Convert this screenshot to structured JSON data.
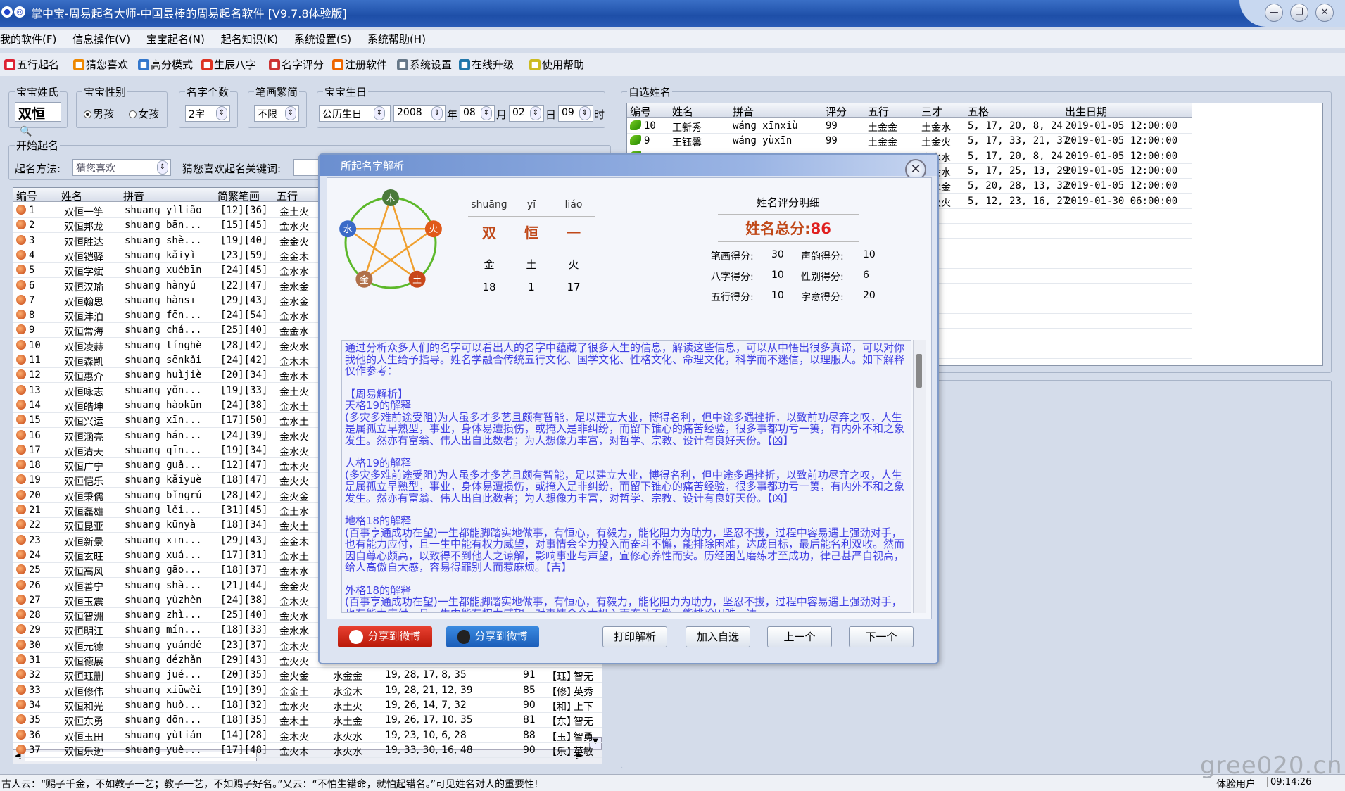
{
  "app": {
    "title": "掌中宝-周易起名大师-中国最棒的周易起名软件 [V9.7.8体验版]"
  },
  "menu": [
    "我的软件(F)",
    "信息操作(V)",
    "宝宝起名(N)",
    "起名知识(K)",
    "系统设置(S)",
    "系统帮助(H)"
  ],
  "toolbar": [
    {
      "label": "五行起名",
      "icon": "wuxing-icon",
      "color": "#d23"
    },
    {
      "label": "猜您喜欢",
      "icon": "star-icon",
      "color": "#e80"
    },
    {
      "label": "高分模式",
      "icon": "chart-icon",
      "color": "#37c"
    },
    {
      "label": "生辰八字",
      "icon": "calendar-icon",
      "color": "#d32"
    },
    {
      "label": "名字评分",
      "icon": "score-icon",
      "color": "#c33"
    },
    {
      "label": "注册软件",
      "icon": "gift-icon",
      "color": "#e60"
    },
    {
      "label": "系统设置",
      "icon": "settings-icon",
      "color": "#678"
    },
    {
      "label": "在线升级",
      "icon": "globe-icon",
      "color": "#27a"
    },
    {
      "label": "使用帮助",
      "icon": "help-icon",
      "color": "#cb2"
    }
  ],
  "settings": {
    "surname_label": "宝宝姓氏",
    "surname": "双恒",
    "gender_label": "宝宝性别",
    "male": "男孩",
    "female": "女孩",
    "count_label": "名字个数",
    "count": "2字",
    "stroke_label": "笔画繁简",
    "stroke": "不限",
    "birth_label": "宝宝生日",
    "calendar": "公历生日",
    "year": "2008",
    "year_unit": "年",
    "month": "08",
    "month_unit": "月",
    "day": "02",
    "day_unit": "日",
    "hour": "09",
    "hour_unit": "时"
  },
  "start": {
    "label": "开始起名",
    "method_label": "起名方法:",
    "method": "猜您喜欢",
    "keyword_label": "猜您喜欢起名关键词:"
  },
  "left_list": {
    "headers": [
      "编号",
      "姓名",
      "拼音",
      "简繁笔画",
      "五行"
    ],
    "rows": [
      [
        "1",
        "双恒一竽",
        "shuanɡ yìlião",
        "[12][36]",
        "金土火"
      ],
      [
        "2",
        "双恒邦龙",
        "shuanɡ bān...",
        "[15][45]",
        "金水火"
      ],
      [
        "3",
        "双恒胜达",
        "shuanɡ shè...",
        "[19][40]",
        "金金火"
      ],
      [
        "4",
        "双恒铠驿",
        "shuanɡ kǎiyì",
        "[23][59]",
        "金金木"
      ],
      [
        "5",
        "双恒学斌",
        "shuanɡ xuébīn",
        "[24][45]",
        "金水水"
      ],
      [
        "6",
        "双恒汉瑜",
        "shuanɡ hànyú",
        "[22][47]",
        "金水金"
      ],
      [
        "7",
        "双恒翰思",
        "shuanɡ hànsī",
        "[29][43]",
        "金水金"
      ],
      [
        "8",
        "双恒沣泊",
        "shuanɡ fēn...",
        "[24][54]",
        "金水水"
      ],
      [
        "9",
        "双恒常海",
        "shuanɡ chá...",
        "[25][40]",
        "金金水"
      ],
      [
        "10",
        "双恒凌赫",
        "shuanɡ línɡhè",
        "[28][42]",
        "金火水"
      ],
      [
        "11",
        "双恒森凯",
        "shuanɡ sēnkǎi",
        "[24][42]",
        "金木木"
      ],
      [
        "12",
        "双恒惠介",
        "shuanɡ huìjiè",
        "[20][34]",
        "金水木"
      ],
      [
        "13",
        "双恒咏志",
        "shuanɡ yǒn...",
        "[19][33]",
        "金土火"
      ],
      [
        "14",
        "双恒皓坤",
        "shuanɡ hàokūn",
        "[24][38]",
        "金水土"
      ],
      [
        "15",
        "双恒兴运",
        "shuanɡ xīn...",
        "[17][50]",
        "金水土"
      ],
      [
        "16",
        "双恒涵亮",
        "shuanɡ hán...",
        "[24][39]",
        "金水火"
      ],
      [
        "17",
        "双恒清天",
        "shuanɡ qīn...",
        "[19][34]",
        "金水火"
      ],
      [
        "18",
        "双恒广宁",
        "shuanɡ ɡuǎ...",
        "[12][47]",
        "金木火"
      ],
      [
        "19",
        "双恒恺乐",
        "shuanɡ kǎiyuè",
        "[18][47]",
        "金火火"
      ],
      [
        "20",
        "双恒秉儒",
        "shuanɡ bǐnɡrú",
        "[28][42]",
        "金火金"
      ],
      [
        "21",
        "双恒磊雄",
        "shuanɡ lěi...",
        "[31][45]",
        "金土水"
      ],
      [
        "22",
        "双恒昆亚",
        "shuanɡ kūnyà",
        "[18][34]",
        "金火土"
      ],
      [
        "23",
        "双恒新景",
        "shuanɡ xīn...",
        "[29][43]",
        "金金木"
      ],
      [
        "24",
        "双恒玄旺",
        "shuanɡ xuá...",
        "[17][31]",
        "金水土"
      ],
      [
        "25",
        "双恒高风",
        "shuanɡ ɡāo...",
        "[18][37]",
        "金木水"
      ],
      [
        "26",
        "双恒善宁",
        "shuanɡ shà...",
        "[21][44]",
        "金金火"
      ],
      [
        "27",
        "双恒玉震",
        "shuanɡ yùzhèn",
        "[24][38]",
        "金木火"
      ],
      [
        "28",
        "双恒智洲",
        "shuanɡ zhì...",
        "[25][40]",
        "金火水"
      ],
      [
        "29",
        "双恒明江",
        "shuanɡ mín...",
        "[18][33]",
        "金水水"
      ],
      [
        "30",
        "双恒元德",
        "shuanɡ yuándé",
        "[23][37]",
        "金木火"
      ],
      [
        "31",
        "双恒德展",
        "shuanɡ dézhǎn",
        "[29][43]",
        "金火火"
      ],
      [
        "32",
        "双恒珏删",
        "shuanɡ jué...",
        "[20][35]",
        "金火金",
        "水金金",
        "19, 28, 17, 8, 35",
        "91",
        "【珏】",
        "智无"
      ],
      [
        "33",
        "双恒修伟",
        "shuanɡ xiūwěi",
        "[19][39]",
        "金金土",
        "水金木",
        "19, 28, 21, 12, 39",
        "85",
        "【修】",
        "英秀"
      ],
      [
        "34",
        "双恒和光",
        "shuanɡ huò...",
        "[18][32]",
        "金水火",
        "水土火",
        "19, 26, 14, 7, 32",
        "90",
        "【和】",
        "上下"
      ],
      [
        "35",
        "双恒东勇",
        "shuanɡ dōn...",
        "[18][35]",
        "金木土",
        "水土金",
        "19, 26, 17, 10, 35",
        "81",
        "【东】",
        "智无"
      ],
      [
        "36",
        "双恒玉田",
        "shuanɡ yùtián",
        "[14][28]",
        "金木火",
        "水火水",
        "19, 23, 10, 6, 28",
        "88",
        "【玉】",
        "智勇"
      ],
      [
        "37",
        "双恒乐逊",
        "shuanɡ yuè...",
        "[17][48]",
        "金火木",
        "水火水",
        "19, 33, 30, 16, 48",
        "90",
        "【乐】",
        "英敏"
      ]
    ]
  },
  "right_list": {
    "group_label": "自选姓名",
    "headers": [
      "编号",
      "姓名",
      "拼音",
      "评分",
      "五行",
      "三才",
      "五格",
      "出生日期"
    ],
    "rows": [
      [
        "10",
        "王新秀",
        "wánɡ xīnxiù",
        "99",
        "土金金",
        "土金水",
        "5, 17, 20, 8, 24",
        "2019-01-05 12:00:00"
      ],
      [
        "9",
        "王钰馨",
        "wánɡ yùxīn",
        "99",
        "土金金",
        "土金火",
        "5, 17, 33, 21, 37",
        "2019-01-05 12:00:00"
      ],
      [
        "",
        "",
        "",
        "",
        "",
        "土水水",
        "5, 17, 20, 8, 24",
        "2019-01-05 12:00:00"
      ],
      [
        "",
        "",
        "",
        "",
        "",
        "土金水",
        "5, 17, 25, 13, 29",
        "2019-01-05 12:00:00"
      ],
      [
        "",
        "",
        "",
        "",
        "",
        "土木金",
        "5, 20, 28, 13, 32",
        "2019-01-05 12:00:00"
      ],
      [
        "",
        "",
        "",
        "",
        "",
        "土火火",
        "5, 12, 23, 16, 27",
        "2019-01-30 06:00:00"
      ]
    ]
  },
  "dialog": {
    "title": "所起名字解析",
    "pinyin": [
      "shuānɡ",
      "yī",
      "liáo"
    ],
    "chars": [
      "双",
      "恒",
      "一"
    ],
    "elements": [
      "金",
      "土",
      "火"
    ],
    "strokes": [
      "18",
      "1",
      "17"
    ],
    "score_title": "姓名评分明细",
    "total_label": "姓名总分:",
    "total": "86",
    "scores": [
      {
        "label": "笔画得分:",
        "value": "30"
      },
      {
        "label": "声韵得分:",
        "value": "10"
      },
      {
        "label": "八字得分:",
        "value": "10"
      },
      {
        "label": "性别得分:",
        "value": "6"
      },
      {
        "label": "五行得分:",
        "value": "10"
      },
      {
        "label": "字意得分:",
        "value": "20"
      }
    ],
    "wuxing_chart": {
      "nodes": [
        "木",
        "火",
        "土",
        "金",
        "水"
      ],
      "colors": [
        "#4a7a3a",
        "#e05a1a",
        "#c8471a",
        "#b0704a",
        "#3a6ac8"
      ]
    },
    "paragraphs": [
      "通过分析众多人们的名字可以看出人的名字中蕴藏了很多人生的信息，解读这些信息，可以从中悟出很多真谛，可以对你我他的人生给予指导。姓名学融合传统五行文化、国学文化、性格文化、命理文化，科学而不迷信，以理服人。如下解释仅作参考：",
      "【周易解析】\n天格19的解释\n(多灾多难前途受阻)为人虽多才多艺且颇有智能，足以建立大业，博得名利，但中途多遇挫折，以致前功尽弃之叹，人生是属孤立早熟型，事业，身体易遭损伤，或掩入是非纠纷，而留下锥心的痛苦经验，很多事都功亏一篑，有内外不和之象发生。然亦有富翁、伟人出自此数者；为人想像力丰富，对哲学、宗教、设计有良好天份。【凶】",
      "人格19的解释\n(多灾多难前途受阻)为人虽多才多艺且颇有智能，足以建立大业，博得名利，但中途多遇挫折，以致前功尽弃之叹，人生是属孤立早熟型，事业，身体易遭损伤，或掩入是非纠纷，而留下锥心的痛苦经验，很多事都功亏一篑，有内外不和之象发生。然亦有富翁、伟人出自此数者；为人想像力丰富，对哲学、宗教、设计有良好天份。【凶】",
      "地格18的解释\n(百事亨通成功在望)一生都能脚踏实地做事，有恒心，有毅力，能化阻力为助力，坚忍不拔，过程中容易遇上强劲对手，也有能力应付，且一生中能有权力威望，对事情会全力投入而奋斗不懈，能排除困难，达成目标，最后能名利双收。然而因自尊心颇高，以致得不到他人之谅解，影响事业与声望，宜修心养性而安。历经困苦磨练才至成功，律己甚严自视高，给人高傲自大感，容易得罪别人而惹麻烦。【吉】",
      "外格18的解释\n(百事亨通成功在望)一生都能脚踏实地做事，有恒心，有毅力，能化阻力为助力，坚忍不拔，过程中容易遇上强劲对手，也有能力应付，且一生中能有权力威望，对事情会全力投入而奋斗不懈，能排除困难，达"
    ],
    "share_sina": "分享到微博",
    "share_qq": "分享到微博",
    "print": "打印解析",
    "add": "加入自选",
    "prev": "上一个",
    "next": "下一个"
  },
  "status": {
    "quote": "古人云：“赐子千金，不如教子一艺；教子一艺，不如赐子好名。”又云：“不怕生错命，就怕起错名。”可见姓名对人的重要性!",
    "user": "体验用户",
    "time": "09:14:26"
  },
  "watermark": "gree020.cn"
}
